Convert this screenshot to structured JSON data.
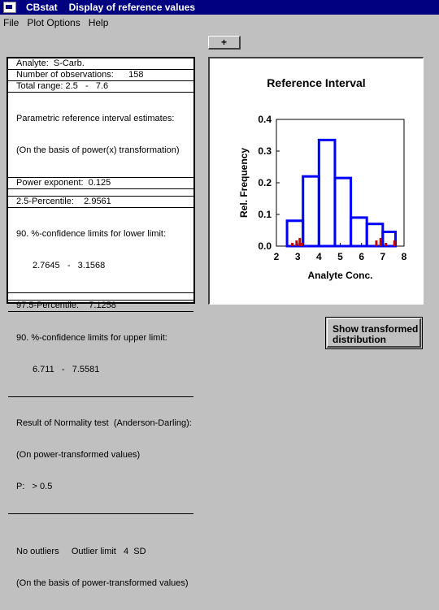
{
  "window": {
    "app_name": "CBstat",
    "title": "Display of reference values"
  },
  "menu": [
    "File",
    "Plot Options",
    "Help"
  ],
  "toolbar": {
    "plus_label": "+"
  },
  "info": {
    "analyte": "Analyte:  S-Carb.",
    "observations": "Number of observations:      158",
    "total_range": "Total range: 2.5   -   7.6",
    "param_title": "Parametric reference interval estimates:",
    "param_basis": "(On the basis of power(x) transformation)",
    "power": "Power exponent:  0.125",
    "p25": "2.5-Percentile:    2.9561",
    "conf_lower_title": "90. %-confidence limits for lower limit:",
    "conf_lower_values": "2.7645   -   3.1568",
    "p975": "97.5-Percentile:    7.1258",
    "conf_upper_title": "90. %-confidence limits for upper limit:",
    "conf_upper_values": "6.711   -   7.5581",
    "normality_title": "Result of Normality test  (Anderson-Darling):",
    "normality_basis": "(On power-transformed values)",
    "p_value": "P:   > 0.5",
    "outliers": "No outliers     Outlier limit   4  SD",
    "outliers_basis": "(On the basis of power-transformed values)"
  },
  "chart_data": {
    "type": "bar",
    "title": "Reference Interval",
    "xlabel": "Analyte Conc.",
    "ylabel": "Rel. Frequency",
    "xlim": [
      2,
      8
    ],
    "ylim": [
      0,
      0.4
    ],
    "xticks": [
      "2",
      "3",
      "4",
      "5",
      "6",
      "7",
      "8"
    ],
    "yticks": [
      "0.0",
      "0.1",
      "0.2",
      "0.3",
      "0.4"
    ],
    "bins": [
      {
        "x0": 2.5,
        "x1": 3.25,
        "value": 0.08
      },
      {
        "x0": 3.25,
        "x1": 4.0,
        "value": 0.22
      },
      {
        "x0": 4.0,
        "x1": 4.75,
        "value": 0.335
      },
      {
        "x0": 4.75,
        "x1": 5.5,
        "value": 0.215
      },
      {
        "x0": 5.5,
        "x1": 6.25,
        "value": 0.09
      },
      {
        "x0": 6.25,
        "x1": 7.0,
        "value": 0.07
      },
      {
        "x0": 7.0,
        "x1": 7.6,
        "value": 0.045
      }
    ],
    "lower_limit_ticks": [
      2.75,
      2.95,
      3.1,
      3.2
    ],
    "upper_limit_ticks": [
      6.7,
      6.9,
      7.15,
      7.55
    ],
    "colors": {
      "bars": "#0000ff",
      "limits": "#c00000"
    }
  },
  "buttons": {
    "show_transformed_line1": "Show transformed",
    "show_transformed_line2": "distribution"
  }
}
